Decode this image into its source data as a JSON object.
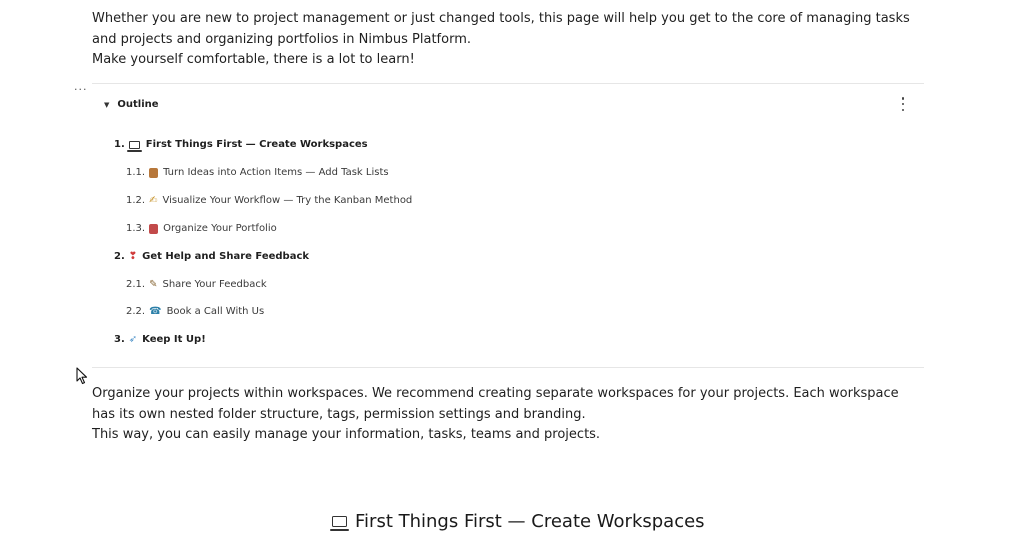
{
  "intro": {
    "line1": "Whether you are new to project management or just changed tools, this page will help you get to the core of managing tasks and projects and organizing portfolios in Nimbus Platform.",
    "line2": "Make yourself comfortable, there is a lot to learn!"
  },
  "block_menu": "...",
  "outline": {
    "title": "Outline",
    "items": [
      {
        "num": "1.",
        "icon": "laptop-icon",
        "label": "First Things First — Create Workspaces"
      },
      {
        "num": "1.1.",
        "icon": "notebook-icon",
        "label": "Turn Ideas into Action Items — Add Task Lists"
      },
      {
        "num": "1.2.",
        "icon": "pen-icon",
        "label": "Visualize Your Workflow — Try the Kanban Method"
      },
      {
        "num": "1.3.",
        "icon": "briefcase-icon",
        "label": "Organize Your Portfolio"
      },
      {
        "num": "2.",
        "icon": "lightbulb-icon",
        "label": "Get Help and Share Feedback"
      },
      {
        "num": "2.1.",
        "icon": "memo-icon",
        "label": "Share Your Feedback"
      },
      {
        "num": "2.2.",
        "icon": "phone-icon",
        "label": "Book a Call With Us"
      },
      {
        "num": "3.",
        "icon": "rocket-icon",
        "label": "Keep It Up!"
      }
    ]
  },
  "body": {
    "para1": "Organize your projects within workspaces. We recommend creating separate workspaces for your projects. Each workspace has its own nested folder structure, tags, permission settings and branding.",
    "para2": "This way, you can easily manage your information, tasks, teams and projects."
  },
  "section_heading": "First Things First — Create Workspaces",
  "colors": {
    "text": "#1f1f1f",
    "divider": "#e6e6e6",
    "notebook": "#b7773a",
    "briefcase": "#c24a4a",
    "lightbulb": "#d03a3a",
    "phone": "#2b7fa8",
    "rocket": "#4a90c8"
  }
}
